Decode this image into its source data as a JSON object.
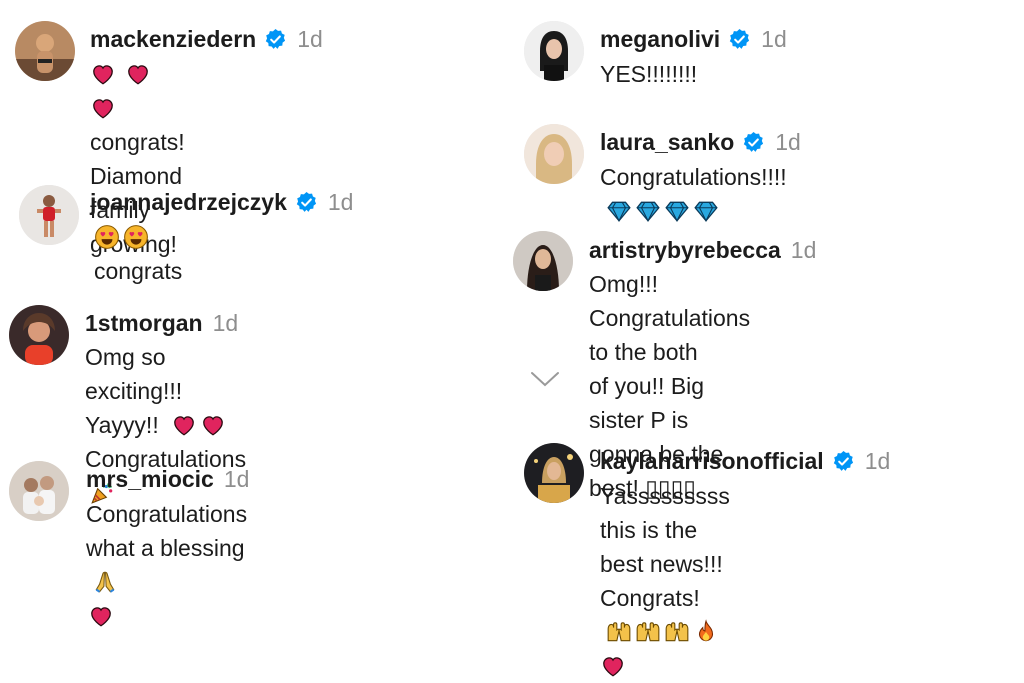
{
  "comments": [
    {
      "user": "mackenziedern",
      "verified": true,
      "time": "1d",
      "text1": "congrats! Diamond family",
      "text2": "growing!"
    },
    {
      "user": "joannajedrzejczyk",
      "verified": true,
      "time": "1d",
      "text1": "congrats"
    },
    {
      "user": "1stmorgan",
      "verified": false,
      "time": "1d",
      "text1": "Omg so exciting!!! Yayyy!!",
      "text2": "Congratulations"
    },
    {
      "user": "mrs_miocic",
      "verified": false,
      "time": "1d",
      "text1": "Congratulations what a blessing"
    },
    {
      "user": "meganolivi",
      "verified": true,
      "time": "1d",
      "text1": "YES!!!!!!!!"
    },
    {
      "user": "laura_sanko",
      "verified": true,
      "time": "1d",
      "text1": "Congratulations!!!!"
    },
    {
      "user": "artistrybyrebecca",
      "verified": false,
      "time": "1d",
      "text1": "Omg!!! Congratulations to the both",
      "text2": "of you!! Big sister P is gonna be the",
      "text3": "best! ▯▯▯▯"
    },
    {
      "user": "kaylaharrisonofficial",
      "verified": true,
      "time": "1d",
      "text1": "Yasssssssss this is the best news!!!",
      "text2": "Congrats!"
    }
  ],
  "icons": {
    "verified": "verified-badge-icon",
    "heart": "red-heart-emoji",
    "heart_eyes": "heart-eyes-emoji",
    "party": "party-popper-emoji",
    "pray": "praying-hands-emoji",
    "diamond": "gem-emoji",
    "raised_hands": "raising-hands-emoji",
    "fire": "fire-emoji",
    "more": "chevron-down-icon"
  },
  "colors": {
    "verified": "#0095f6",
    "heart": "#e0245e",
    "time": "#8e8e8e",
    "diamond": "#29a8e0"
  }
}
